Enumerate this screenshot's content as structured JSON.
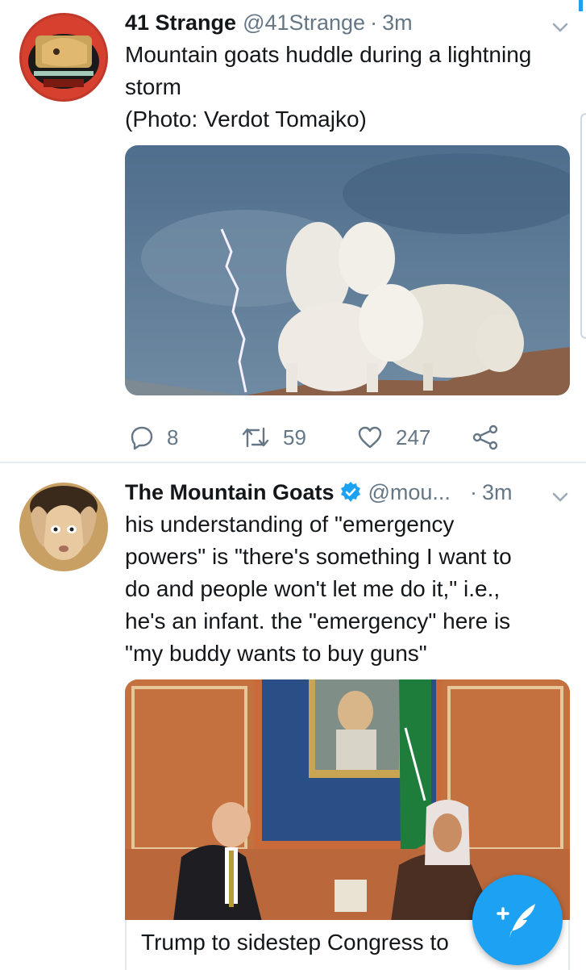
{
  "tweets": [
    {
      "name": "41 Strange",
      "handle": "@41Strange",
      "time": "3m",
      "text_lines": [
        "Mountain goats huddle during a lightning",
        "storm",
        "(Photo: Verdot Tomajko)"
      ],
      "media_alt": "mountain goats photo",
      "replies": "8",
      "retweets": "59",
      "likes": "247"
    },
    {
      "name": "The Mountain Goats",
      "handle": "@mou...",
      "time": "3m",
      "verified": true,
      "text_lines": [
        "his understanding of \"emergency",
        "powers\" is \"there's something I want to",
        "do and people won't let me do it,\" i.e.,",
        "he's an infant. the \"emergency\" here is",
        "\"my buddy wants to buy guns\""
      ],
      "card_title": "Trump to sidestep Congress to"
    }
  ],
  "colors": {
    "accent": "#1da1f2",
    "secondary_text": "#657786",
    "divider": "#e6ecf0"
  },
  "icons": {
    "reply": "reply-icon",
    "retweet": "retweet-icon",
    "like": "heart-icon",
    "share": "share-icon",
    "compose": "compose-tweet-icon",
    "menu": "chevron-down-icon",
    "verified": "verified-badge-icon"
  }
}
